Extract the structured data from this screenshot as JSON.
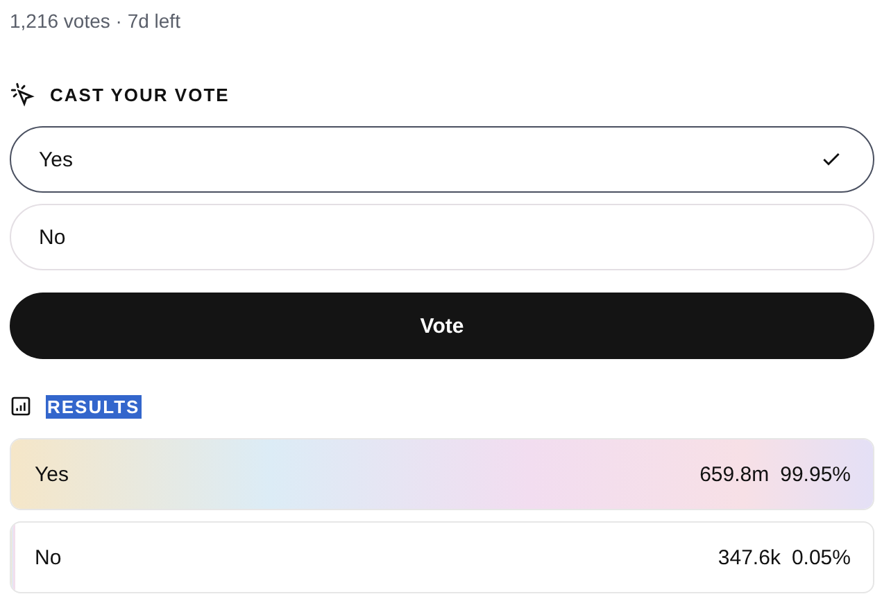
{
  "meta": "1,216 votes · 7d left",
  "vote_section": {
    "title": "CAST YOUR VOTE",
    "options": [
      {
        "label": "Yes",
        "selected": true
      },
      {
        "label": "No",
        "selected": false
      }
    ],
    "button": "Vote"
  },
  "results_section": {
    "title": "RESULTS",
    "highlighted": true,
    "results": [
      {
        "label": "Yes",
        "count": "659.8m",
        "percent": "99.95%",
        "level": 0.9995
      },
      {
        "label": "No",
        "count": "347.6k",
        "percent": "0.05%",
        "level": 0.0005
      }
    ]
  }
}
